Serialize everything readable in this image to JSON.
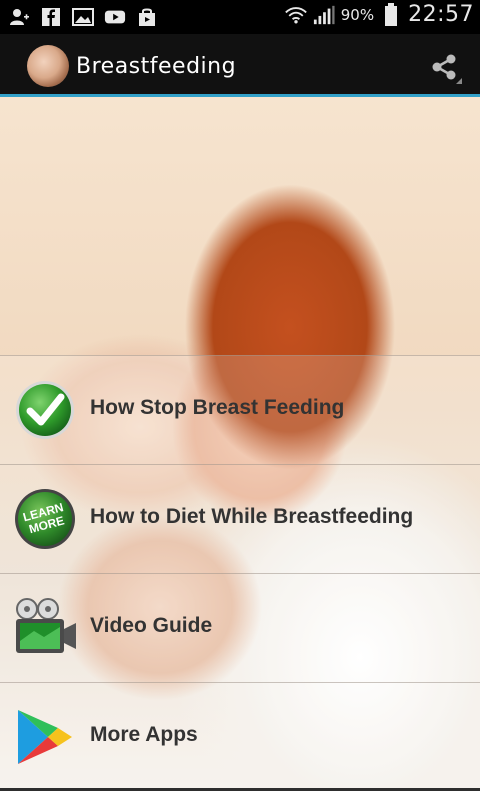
{
  "status_bar": {
    "battery": "90%",
    "time": "22:57",
    "icons": [
      "person-add-icon",
      "facebook-icon",
      "image-icon",
      "youtube-icon",
      "store-icon",
      "wifi-icon",
      "signal-icon",
      "battery-icon"
    ]
  },
  "app_bar": {
    "title": "Breastfeeding",
    "share_icon": "share-icon"
  },
  "menu": {
    "items": [
      {
        "label": "How Stop Breast Feeding",
        "icon": "checkmark-icon"
      },
      {
        "label": "How to Diet While Breastfeeding",
        "icon": "learn-more-icon",
        "icon_text": "LEARN MORE"
      },
      {
        "label": "Video Guide",
        "icon": "video-camera-icon"
      },
      {
        "label": "More Apps",
        "icon": "play-store-icon"
      }
    ]
  },
  "colors": {
    "accent_line": "#32a0c8",
    "check_green": "#2e9a2a",
    "label_text": "#333333"
  }
}
